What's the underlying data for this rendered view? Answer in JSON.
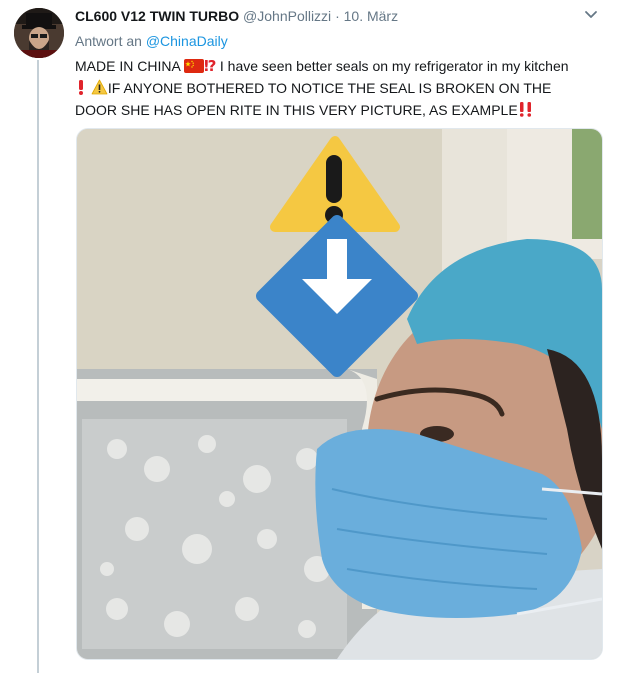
{
  "tweet": {
    "display_name": "CL600 V12 TWIN TURBO",
    "handle": "@JohnPollizzi",
    "separator": "·",
    "date": "10. März",
    "reply_prefix": "Antwort an",
    "reply_mention": "@ChinaDaily",
    "text_part1": "MADE IN CHINA ",
    "text_part2": "I have seen better seals on my refrigerator in my kitchen",
    "text_part3": "IF ANYONE BOTHERED TO NOTICE THE SEAL IS BROKEN ON THE DOOR SHE HAS OPEN RITE IN THIS VERY PICTURE, AS EXAMPLE",
    "icons": [
      "flag-china-icon",
      "exclamation-question-icon",
      "red-exclamation-icon",
      "warning-icon",
      "double-exclamation-icon",
      "caret-down-icon"
    ]
  },
  "colors": {
    "link": "#1b95e0",
    "secondary_text": "#657786",
    "thread_line": "#c4cfd6",
    "warning_yellow": "#f5c842",
    "arrow_blue": "#3b84c9",
    "mask_blue": "#6aaedc"
  }
}
